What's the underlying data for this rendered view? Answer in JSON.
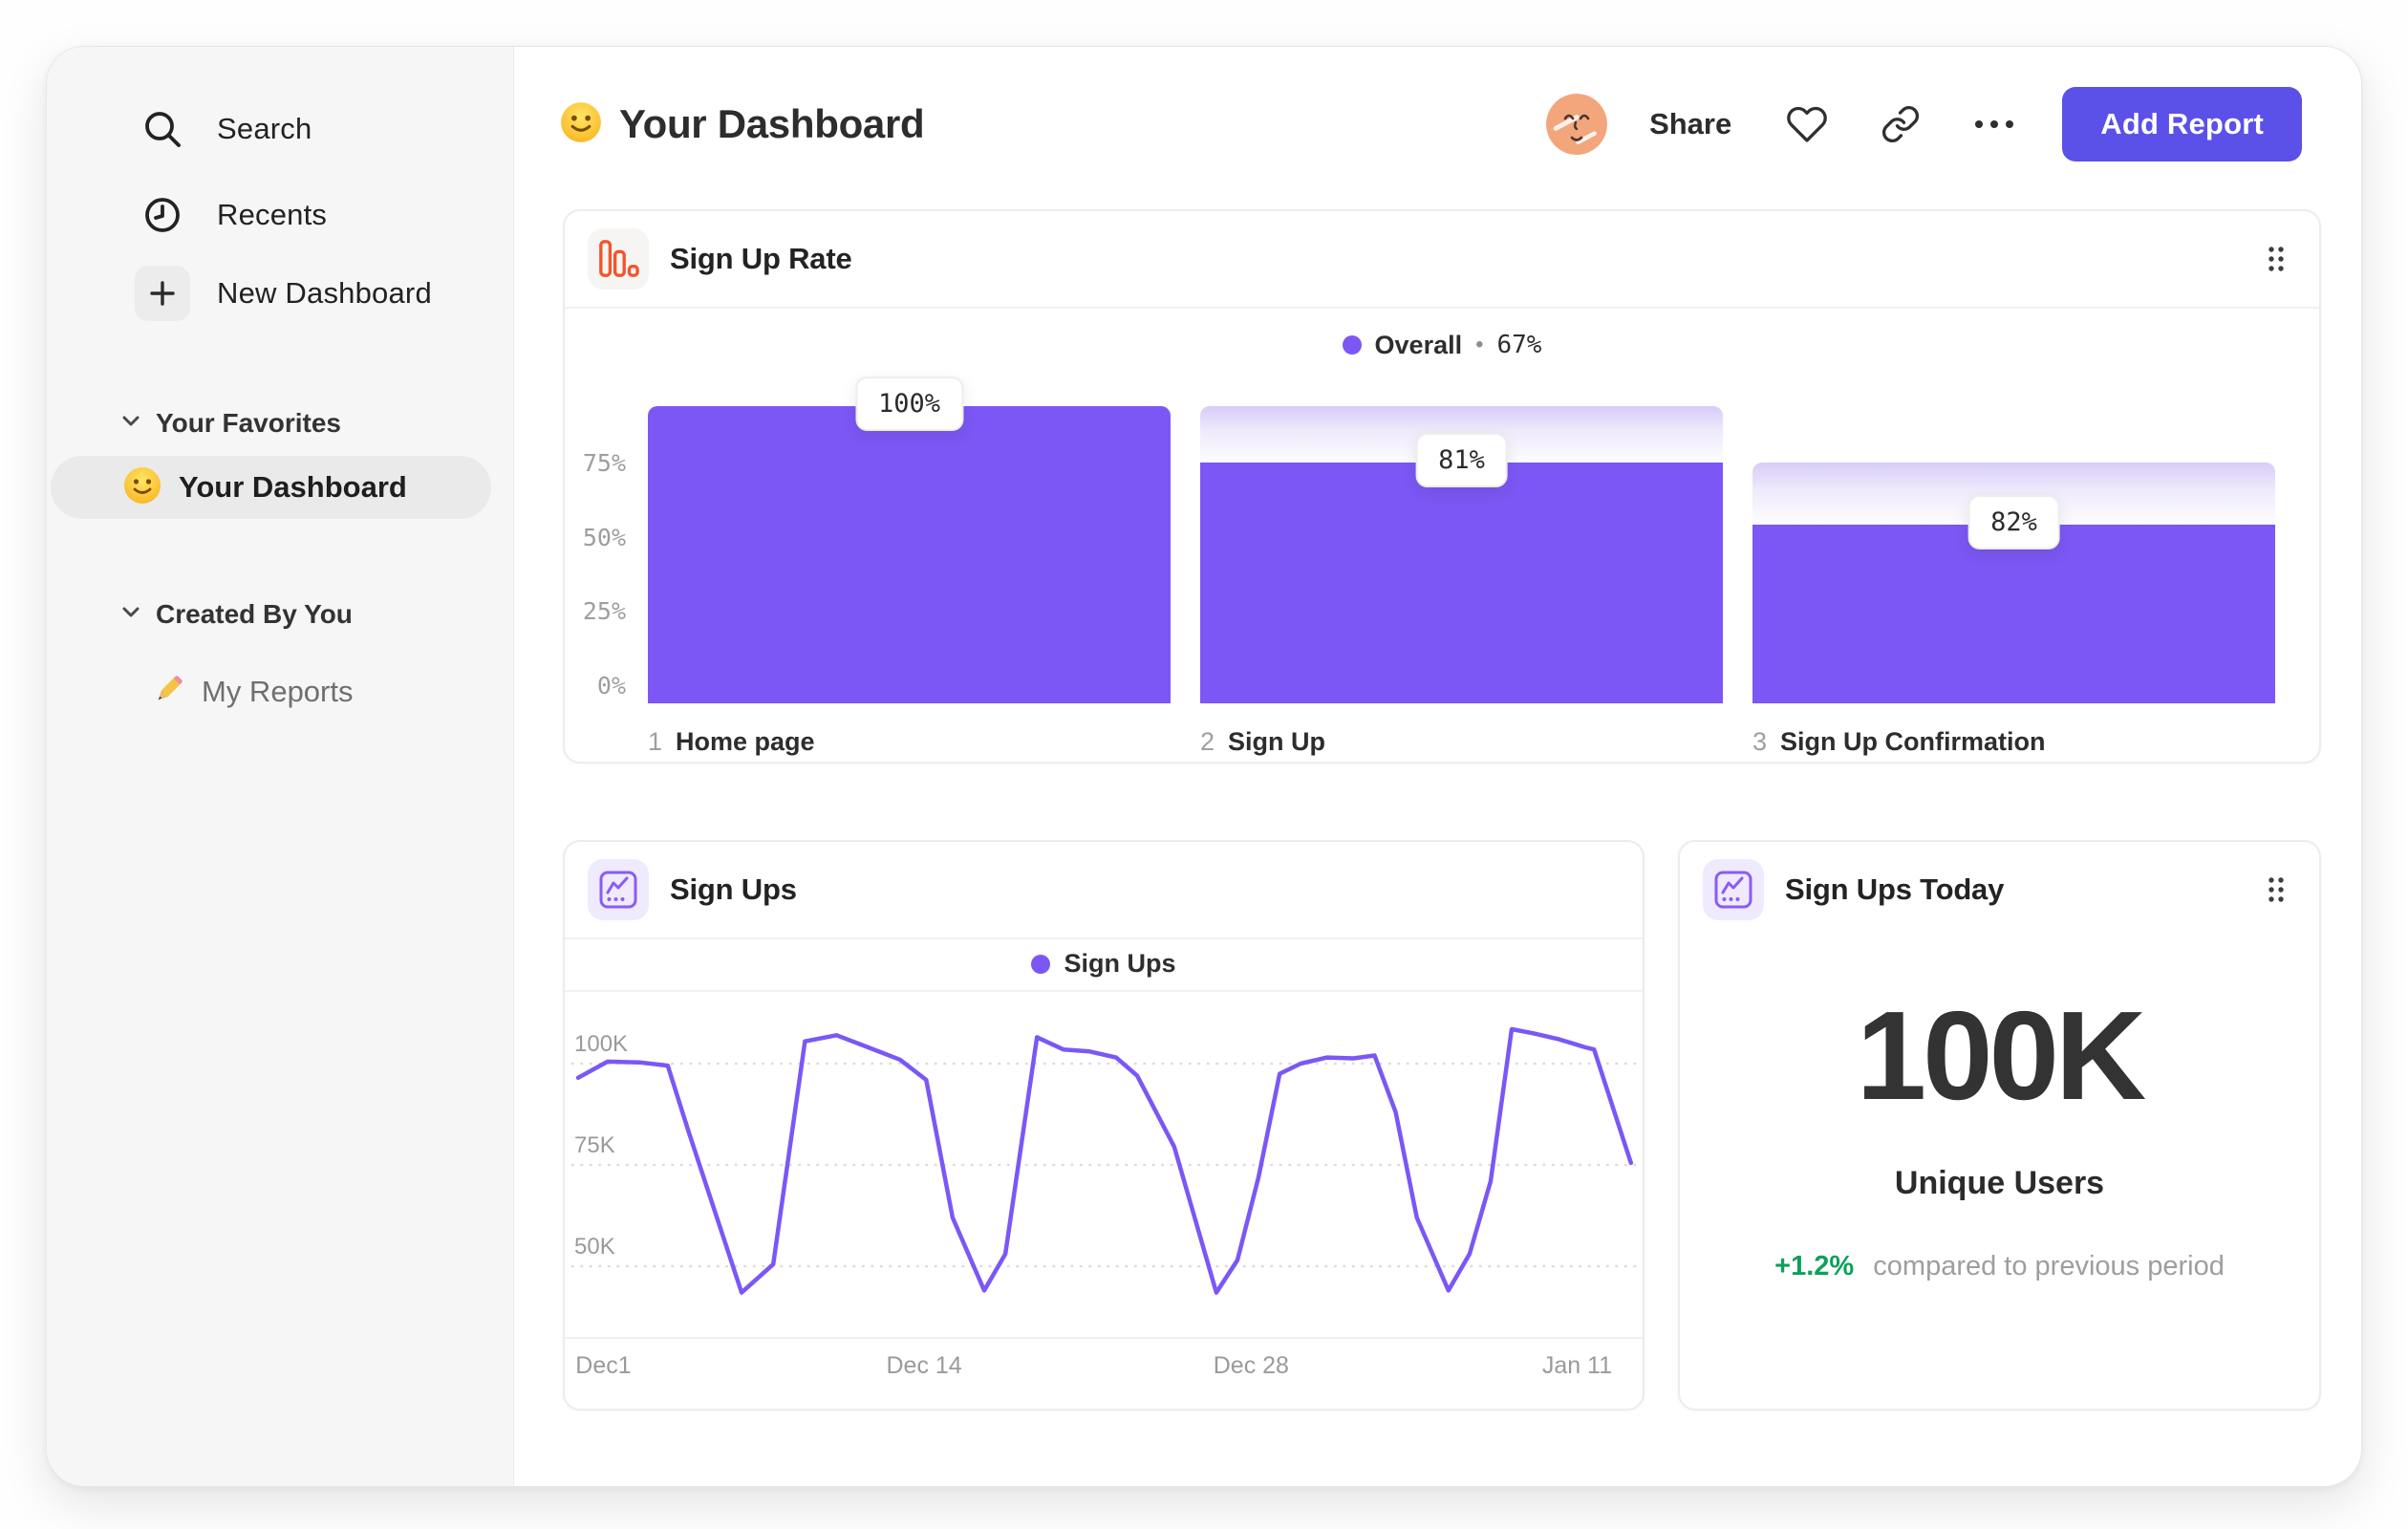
{
  "sidebar": {
    "items": [
      {
        "label": "Search",
        "icon": "search-icon"
      },
      {
        "label": "Recents",
        "icon": "clock-icon"
      },
      {
        "label": "New Dashboard",
        "icon": "plus-icon"
      }
    ],
    "sections": [
      {
        "label": "Your Favorites",
        "items": [
          {
            "label": "Your Dashboard",
            "icon": "smiley-emoji",
            "selected": true
          }
        ]
      },
      {
        "label": "Created By You",
        "items": [
          {
            "label": "My Reports",
            "icon": "pencil-emoji",
            "selected": false
          }
        ]
      }
    ]
  },
  "header": {
    "title": "Your Dashboard",
    "title_emoji": "smiley-emoji",
    "share_label": "Share",
    "add_report_label": "Add Report"
  },
  "cards": {
    "signup_rate": {
      "title": "Sign Up Rate",
      "legend": {
        "series": "Overall",
        "separator": "•",
        "value": "67%"
      }
    },
    "signups": {
      "title": "Sign Ups",
      "legend": {
        "series": "Sign Ups"
      }
    },
    "signups_today": {
      "title": "Sign Ups Today",
      "value": "100K",
      "label": "Unique Users",
      "delta": "+1.2%",
      "delta_caption": "compared to previous period"
    }
  },
  "colors": {
    "accent_purple": "#7c57f5",
    "button_purple": "#5b50e7",
    "dropoff_lavender": "#d7ccf8",
    "positive_green": "#0ca15c",
    "funnel_icon_orange": "#f2552c"
  },
  "chart_data": [
    {
      "id": "signup-rate-funnel",
      "type": "bar",
      "title": "Sign Up Rate",
      "legend": "Overall • 67%",
      "overall_conversion": "67%",
      "steps": [
        {
          "index": "1",
          "label": "Home page",
          "conversion": "100%",
          "total_pct": 100,
          "value_pct": 100
        },
        {
          "index": "2",
          "label": "Sign Up",
          "conversion": "81%",
          "total_pct": 100,
          "value_pct": 81
        },
        {
          "index": "3",
          "label": "Sign Up Confirmation",
          "conversion": "82%",
          "total_pct": 81,
          "value_pct": 60
        }
      ],
      "y_ticks": [
        {
          "label": "75%",
          "value": 75
        },
        {
          "label": "50%",
          "value": 50
        },
        {
          "label": "25%",
          "value": 25
        },
        {
          "label": "0%",
          "value": 0
        }
      ],
      "ylim": [
        0,
        100
      ]
    },
    {
      "id": "signups-line",
      "type": "line",
      "title": "Sign Ups",
      "series_name": "Sign Ups",
      "unit": "K users",
      "ylim": [
        40,
        110
      ],
      "y_ticks": [
        {
          "label": "100K",
          "value": 100
        },
        {
          "label": "75K",
          "value": 75
        },
        {
          "label": "50K",
          "value": 50
        }
      ],
      "x_ticks": [
        {
          "label": "Dec1",
          "pos": 0.024
        },
        {
          "label": "Dec 14",
          "pos": 0.328
        },
        {
          "label": "Dec 28",
          "pos": 0.638
        },
        {
          "label": "Jan 11",
          "pos": 0.947
        }
      ],
      "points": [
        [
          0.0,
          96.5
        ],
        [
          0.028,
          100.5
        ],
        [
          0.058,
          100.3
        ],
        [
          0.085,
          99.5
        ],
        [
          0.105,
          83
        ],
        [
          0.155,
          43.5
        ],
        [
          0.185,
          50.5
        ],
        [
          0.215,
          105.5
        ],
        [
          0.245,
          107
        ],
        [
          0.275,
          104
        ],
        [
          0.305,
          101
        ],
        [
          0.33,
          96
        ],
        [
          0.355,
          62
        ],
        [
          0.385,
          44
        ],
        [
          0.405,
          53
        ],
        [
          0.435,
          106.5
        ],
        [
          0.46,
          103.5
        ],
        [
          0.485,
          103
        ],
        [
          0.51,
          101.5
        ],
        [
          0.53,
          97
        ],
        [
          0.55,
          87
        ],
        [
          0.565,
          79.5
        ],
        [
          0.605,
          43.5
        ],
        [
          0.625,
          51.5
        ],
        [
          0.645,
          72
        ],
        [
          0.665,
          97.5
        ],
        [
          0.685,
          100
        ],
        [
          0.71,
          101.5
        ],
        [
          0.735,
          101.3
        ],
        [
          0.755,
          102
        ],
        [
          0.775,
          88
        ],
        [
          0.795,
          62
        ],
        [
          0.825,
          44
        ],
        [
          0.845,
          53
        ],
        [
          0.865,
          71
        ],
        [
          0.885,
          108.5
        ],
        [
          0.905,
          107.5
        ],
        [
          0.93,
          106
        ],
        [
          0.955,
          104
        ],
        [
          0.963,
          103.5
        ],
        [
          0.998,
          75.5
        ]
      ]
    }
  ]
}
